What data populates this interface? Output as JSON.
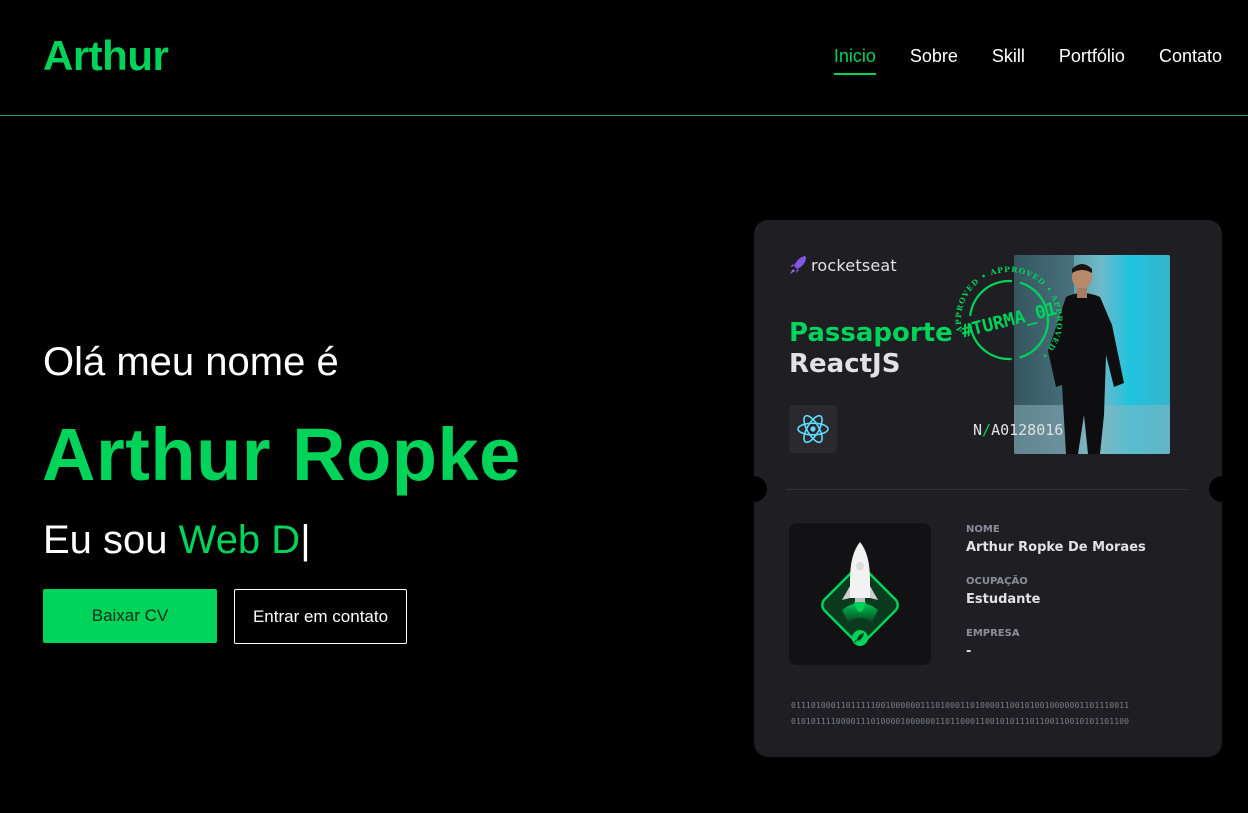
{
  "header": {
    "logo": "Arthur",
    "nav": [
      {
        "label": "Inicio",
        "active": true
      },
      {
        "label": "Sobre",
        "active": false
      },
      {
        "label": "Skill",
        "active": false
      },
      {
        "label": "Portfólio",
        "active": false
      },
      {
        "label": "Contato",
        "active": false
      }
    ]
  },
  "hero": {
    "greeting": "Olá meu nome é",
    "name": "Arthur Ropke",
    "role_prefix": "Eu sou",
    "role_typed": "Web D",
    "cursor": "|",
    "primary_button": "Baixar CV",
    "secondary_button": "Entrar em contato"
  },
  "passport": {
    "brand": "rocketseat",
    "title": "Passaporte",
    "subtitle": "ReactJS",
    "stamp_text": "#TURMA_01",
    "stamp_ring": "APPROVED • APPROVED • APPROVED •",
    "number_prefix": "N",
    "number_slash": "/",
    "number": "A0128016",
    "fields": {
      "nome_label": "NOME",
      "nome_value": "Arthur Ropke De Moraes",
      "ocupacao_label": "OCUPAÇÃO",
      "ocupacao_value": "Estudante",
      "empresa_label": "EMPRESA",
      "empresa_value": "-"
    },
    "binary_line_1": "01110100011011111001000000111010001101000011001010010000001101110011",
    "binary_line_2": "01010111100001110100001000000110110001100101011101100110010101101100"
  },
  "colors": {
    "accent": "#00d35a",
    "background": "#000000",
    "card": "#1f1f23",
    "rocketseat_purple": "#8257e5",
    "react_blue": "#61dafb"
  },
  "icons": [
    "rocketseat-logo-icon",
    "react-icon",
    "rocket-badge-icon",
    "approved-stamp"
  ]
}
